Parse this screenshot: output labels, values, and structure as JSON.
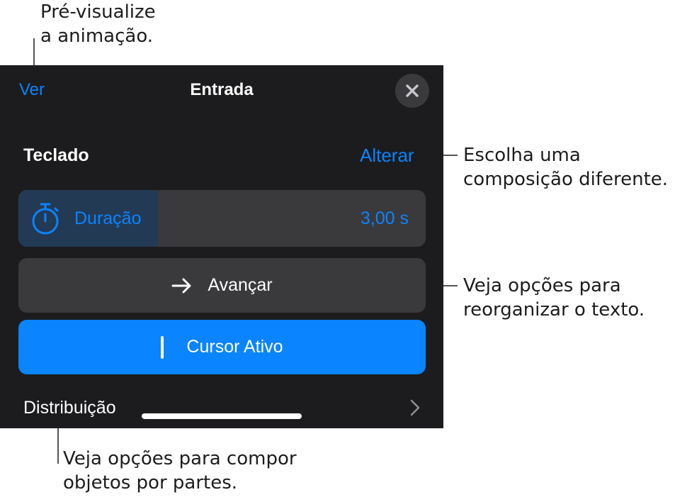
{
  "callouts": {
    "preview": [
      "Pré-visualize",
      "a animação."
    ],
    "composition": [
      "Escolha uma",
      "composição diferente."
    ],
    "reorganize": [
      "Veja opções para",
      "reorganizar o texto."
    ],
    "parts": [
      "Veja opções para compor",
      "objetos por partes."
    ]
  },
  "header": {
    "preview_label": "Ver",
    "title": "Entrada",
    "close_icon": "close-icon"
  },
  "composition": {
    "label": "Teclado",
    "change_label": "Alterar"
  },
  "duration": {
    "icon": "timer-icon",
    "label": "Duração",
    "value": "3,00 s",
    "fill_fraction": 0.345
  },
  "advance": {
    "icon": "arrow-right-icon",
    "label": "Avançar"
  },
  "cursor": {
    "icon": "text-cursor-icon",
    "label": "Cursor Ativo"
  },
  "distribution": {
    "label": "Distribuição",
    "icon": "chevron-right-icon"
  },
  "colors": {
    "accent": "#0a84ff",
    "panel": "#1c1c1e",
    "control": "#3a3a3c"
  }
}
